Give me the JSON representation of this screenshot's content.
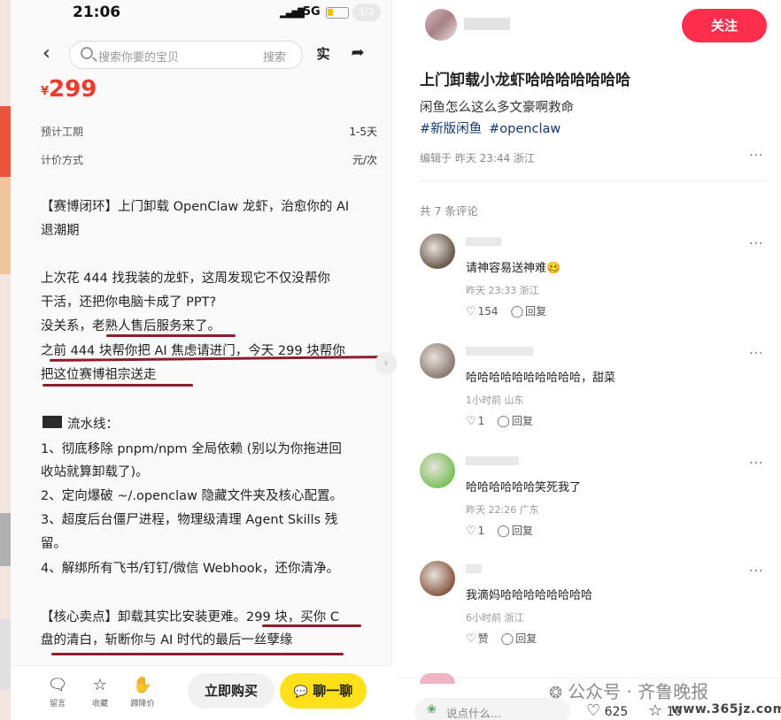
{
  "phone": {
    "status": {
      "time": "21:06",
      "network": "5G",
      "page_indicator": "1/2",
      "battery_level": 0.3
    },
    "search": {
      "placeholder": "搜索你要的宝贝",
      "button": "搜索"
    },
    "price": {
      "currency": "¥",
      "value": "299"
    },
    "details": [
      {
        "label": "预计工期",
        "value": "1-5天"
      },
      {
        "label": "计价方式",
        "value": "元/次"
      }
    ],
    "description": [
      "【赛博闭环】上门卸载 OpenClaw 龙虾，治愈你的 AI",
      "退潮期",
      "上次花 444 找我装的龙虾，这周发现它不仅没帮你",
      "干活，还把你电脑卡成了 PPT?",
      "没关系，老熟人售后服务来了。",
      "之前 444 块帮你把 AI 焦虑请进门，今天 299 块帮你",
      "把这位赛博祖宗送走",
      "流水线：",
      "1、彻底移除 pnpm/npm 全局依赖 (别以为你拖进回",
      "收站就算卸载了)。",
      "2、定向爆破 ~/.openclaw 隐藏文件夹及核心配置。",
      "3、超度后台僵尸进程，物理级清理 Agent Skills 残",
      "留。",
      "4、解绑所有飞书/钉钉/微信 Webhook，还你清净。",
      "【核心卖点】卸载其实比安装更难。299 块，买你 C",
      "盘的清白，斩断你与 AI 时代的最后一丝孽缘"
    ],
    "bottom_bar": {
      "items": [
        {
          "label": "留言",
          "icon": "chat-bubble-icon"
        },
        {
          "label": "收藏",
          "icon": "star-icon"
        },
        {
          "label": "蹲降价",
          "icon": "hand-icon"
        }
      ],
      "buy_label": "立即购买",
      "chat_label": "聊一聊"
    }
  },
  "post": {
    "follow_label": "关注",
    "title": "上门卸载小龙虾哈哈哈哈哈哈哈",
    "body": "闲鱼怎么这么多文豪啊救命",
    "tags": [
      "#新版闲鱼",
      "#openclaw"
    ],
    "edit_meta": "编辑于 昨天 23:44 浙江",
    "comment_count": "共 7 条评论",
    "comments": [
      {
        "text": "请神容易送神难🥴",
        "meta": "昨天 23:33 浙江",
        "likes": "154",
        "reply": "回复",
        "avatar_color": "#6b5a4a"
      },
      {
        "text": "哈哈哈哈哈哈哈哈哈哈，甜菜",
        "meta": "1小时前 山东",
        "likes": "1",
        "reply": "回复",
        "avatar_color": "#8a7d72"
      },
      {
        "text": "哈哈哈哈哈哈笑死我了",
        "meta": "昨天 22:26 广东",
        "likes": "1",
        "reply": "回复",
        "avatar_color": "#7cc25c"
      },
      {
        "text": "我滴妈哈哈哈哈哈哈哈哈",
        "meta": "6小时前 浙江",
        "likes": "赞",
        "reply": "回复",
        "avatar_color": "#8a5a45"
      }
    ],
    "bottom": {
      "comment_placeholder": "说点什么...",
      "likes": "625",
      "collects": "10"
    }
  },
  "watermark": {
    "line1": "公众号 · 齐鲁晚报",
    "line2": "www.365jz.com"
  }
}
